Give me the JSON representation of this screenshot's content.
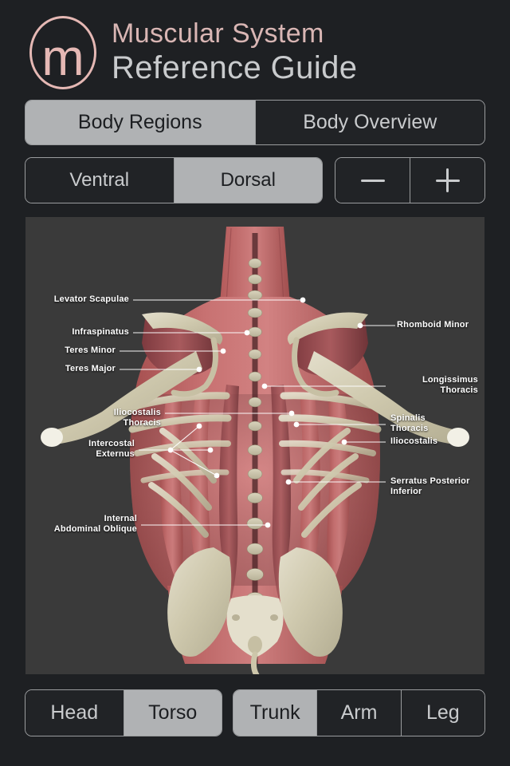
{
  "app": {
    "logo_letter": "m",
    "title_line1": "Muscular System",
    "title_line2": "Reference Guide",
    "logo_color": "#e5b8b4",
    "title_color_1": "#d9b6b4",
    "title_color_2": "#c9cbcd",
    "background_color": "#1e2023",
    "viewer_background": "#3a3a3a",
    "accent_active": "#b0b2b4"
  },
  "main_tabs": {
    "items": [
      {
        "label": "Body Regions",
        "selected": true
      },
      {
        "label": "Body Overview",
        "selected": false
      }
    ]
  },
  "view_toggle": {
    "items": [
      {
        "label": "Ventral",
        "selected": false
      },
      {
        "label": "Dorsal",
        "selected": true
      }
    ]
  },
  "zoom_controls": {
    "items": [
      {
        "icon": "minus-icon",
        "label": "−"
      },
      {
        "icon": "plus-icon",
        "label": "+"
      }
    ]
  },
  "region_nav": {
    "items": [
      {
        "label": "Head",
        "selected": false
      },
      {
        "label": "Torso",
        "selected": true
      }
    ]
  },
  "part_nav": {
    "items": [
      {
        "label": "Trunk",
        "selected": true
      },
      {
        "label": "Arm",
        "selected": false
      },
      {
        "label": "Leg",
        "selected": false
      }
    ]
  },
  "viewer": {
    "view_name": "Dorsal",
    "region": "Torso",
    "part": "Trunk",
    "labels": [
      {
        "id": "levator-scapulae",
        "text": "Levator Scapulae",
        "side": "left",
        "lines": [
          "Levator Scapulae"
        ]
      },
      {
        "id": "infraspinatus",
        "text": "Infraspinatus",
        "side": "left",
        "lines": [
          "Infraspinatus"
        ]
      },
      {
        "id": "teres-minor",
        "text": "Teres Minor",
        "side": "left",
        "lines": [
          "Teres Minor"
        ]
      },
      {
        "id": "teres-major",
        "text": "Teres Major",
        "side": "left",
        "lines": [
          "Teres Major"
        ]
      },
      {
        "id": "iliocostalis-thoracis",
        "text": "Iliocostalis Thoracis",
        "side": "left",
        "lines": [
          "Iliocostalis",
          "Thoracis"
        ]
      },
      {
        "id": "intercostal-externus",
        "text": "Intercostal Externus",
        "side": "left",
        "lines": [
          "Intercostal",
          "Externus"
        ]
      },
      {
        "id": "internal-abdominal-oblique",
        "text": "Internal Abdominal Oblique",
        "side": "left",
        "lines": [
          "Internal",
          "Abdominal Oblique"
        ]
      },
      {
        "id": "rhomboid-minor",
        "text": "Rhomboid Minor",
        "side": "right",
        "lines": [
          "Rhomboid Minor"
        ]
      },
      {
        "id": "longissimus-thoracis",
        "text": "Longissimus Thoracis",
        "side": "right",
        "lines": [
          "Longissimus",
          "Thoracis"
        ]
      },
      {
        "id": "spinalis-thoracis",
        "text": "Spinalis Thoracis",
        "side": "right",
        "lines": [
          "Spinalis",
          "Thoracis"
        ]
      },
      {
        "id": "iliocostalis",
        "text": "Iliocostalis",
        "side": "right",
        "lines": [
          "Iliocostalis"
        ]
      },
      {
        "id": "serratus-posterior-inferior",
        "text": "Serratus Posterior Inferior",
        "side": "right",
        "lines": [
          "Serratus Posterior",
          "Inferior"
        ]
      }
    ]
  }
}
